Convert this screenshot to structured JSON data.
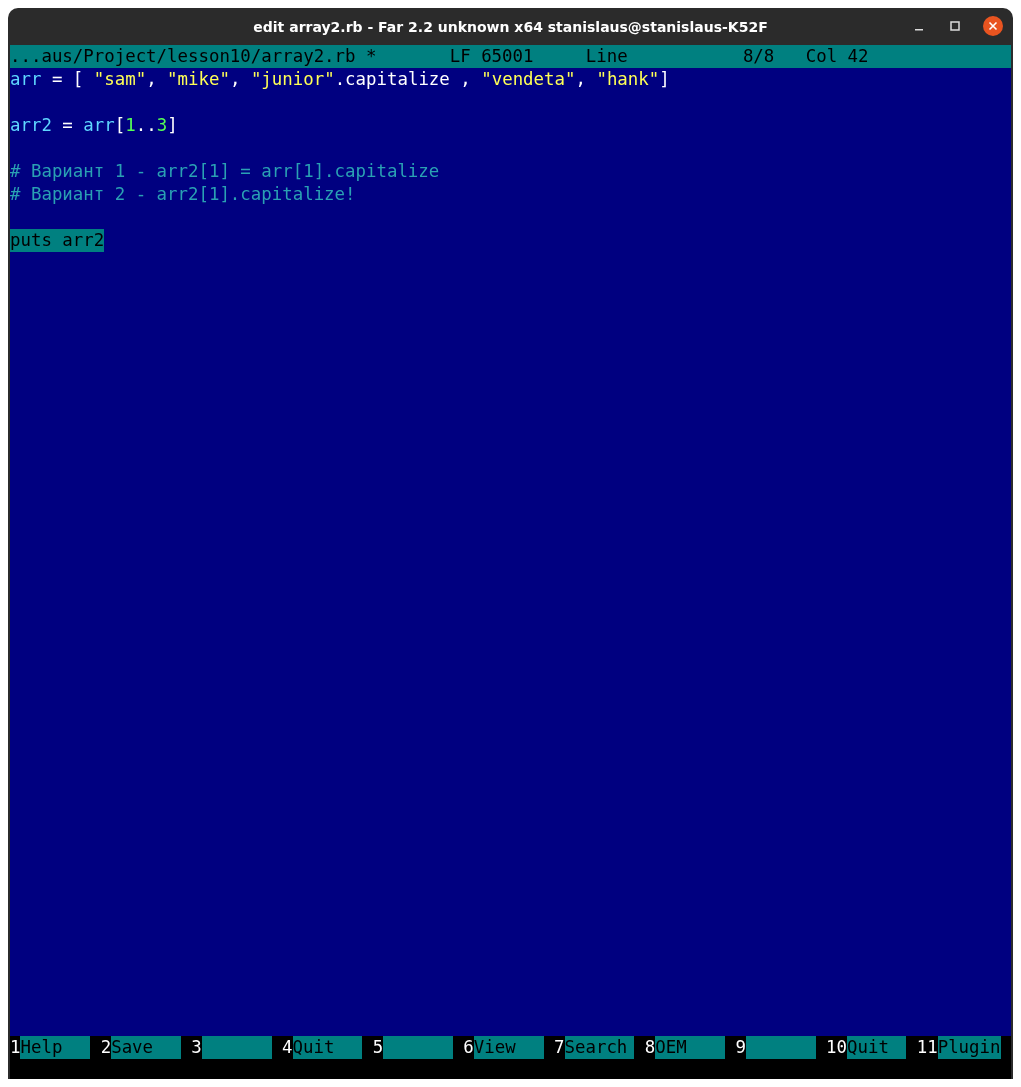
{
  "window": {
    "title": "edit array2.rb - Far 2.2 unknown x64 stanislaus@stanislaus-K52F"
  },
  "status_bar": {
    "path": "...aus/Project/lesson10/array2.rb *",
    "encoding": "LF 65001",
    "line_label": "Line",
    "line_value": "8/8",
    "column": "Col 42"
  },
  "editor": {
    "lines": [
      {
        "selected": false,
        "tokens": [
          {
            "kind": "ident",
            "text": "arr"
          },
          {
            "kind": "plain",
            "text": " = [ "
          },
          {
            "kind": "string",
            "text": "\"sam\""
          },
          {
            "kind": "plain",
            "text": ", "
          },
          {
            "kind": "string",
            "text": "\"mike\""
          },
          {
            "kind": "plain",
            "text": ", "
          },
          {
            "kind": "string",
            "text": "\"junior\""
          },
          {
            "kind": "plain",
            "text": ".capitalize , "
          },
          {
            "kind": "string",
            "text": "\"vendeta\""
          },
          {
            "kind": "plain",
            "text": ", "
          },
          {
            "kind": "string",
            "text": "\"hank\""
          },
          {
            "kind": "plain",
            "text": "]"
          }
        ]
      },
      {
        "selected": false
      },
      {
        "selected": false,
        "tokens": [
          {
            "kind": "ident",
            "text": "arr2"
          },
          {
            "kind": "plain",
            "text": " = "
          },
          {
            "kind": "ident",
            "text": "arr"
          },
          {
            "kind": "plain",
            "text": "["
          },
          {
            "kind": "number",
            "text": "1"
          },
          {
            "kind": "plain",
            "text": ".."
          },
          {
            "kind": "number",
            "text": "3"
          },
          {
            "kind": "plain",
            "text": "]"
          }
        ]
      },
      {
        "selected": false
      },
      {
        "selected": false,
        "tokens": [
          {
            "kind": "comment",
            "text": "# Вариант 1 - arr2[1] = arr[1].capitalize"
          }
        ]
      },
      {
        "selected": false,
        "tokens": [
          {
            "kind": "comment",
            "text": "# Вариант 2 - arr2[1].capitalize!"
          }
        ]
      },
      {
        "selected": false
      },
      {
        "selected": true,
        "tokens": [
          {
            "kind": "plain",
            "text": "puts arr2"
          }
        ]
      }
    ]
  },
  "function_keys": [
    {
      "number": "1",
      "label": "Help"
    },
    {
      "number": "2",
      "label": "Save"
    },
    {
      "number": "3"
    },
    {
      "number": "4",
      "label": "Quit"
    },
    {
      "number": "5"
    },
    {
      "number": "6",
      "label": "View"
    },
    {
      "number": "7",
      "label": "Search"
    },
    {
      "number": "8",
      "label": "OEM"
    },
    {
      "number": "9"
    },
    {
      "number": "10",
      "label": "Quit"
    },
    {
      "number": "11",
      "label": "Plugin"
    }
  ]
}
